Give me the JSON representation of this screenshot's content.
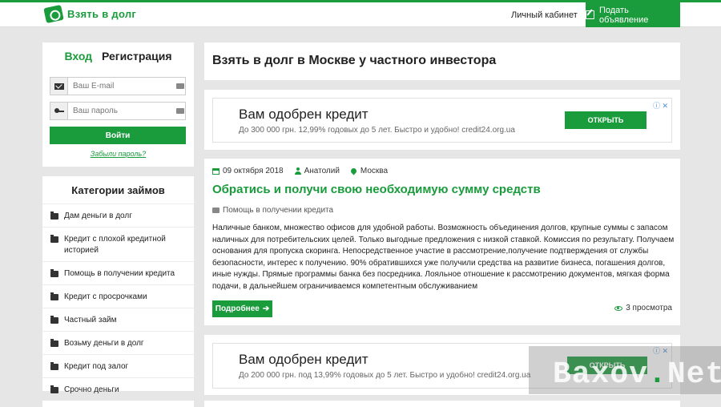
{
  "header": {
    "logo_text": "Взять в долг",
    "cabinet_label": "Личный кабинет",
    "post_ad_label": "Подать объявление"
  },
  "login": {
    "tab_login": "Вход",
    "tab_register": "Регистрация",
    "email_placeholder": "Ваш E-mail",
    "password_placeholder": "Ваш пароль",
    "submit_label": "Войти",
    "forgot_label": "Забыли пароль?"
  },
  "categories": {
    "title": "Категории займов",
    "items": [
      "Дам деньги в долг",
      "Кредит с плохой кредитной историей",
      "Помощь в получении кредита",
      "Кредит с просрочками",
      "Частный займ",
      "Возьму деньги в долг",
      "Кредит под залог",
      "Срочно деньги"
    ]
  },
  "main": {
    "page_title": "Взять в долг в Москве у частного инвестора",
    "ads": [
      {
        "title": "Вам одобрен кредит",
        "subtitle": "До 300 000 грн. 12,99% годовых до 5 лет. Быстро и удобно! credit24.org.ua",
        "button": "ОТКРЫТЬ",
        "icons": "ⓘ ✕"
      },
      {
        "title": "Вам одобрен кредит",
        "subtitle": "До 200 000 грн. под 13,99% годовых до 5 лет. Быстро и удобно! credit24.org.ua",
        "button": "ОТКРЫТЬ",
        "icons": "ⓘ ✕"
      }
    ],
    "post": {
      "date": "09 октября 2018",
      "author": "Анатолий",
      "city": "Москва",
      "title": "Обратись и получи свою необходимую сумму средств",
      "category": "Помощь в получении кредита",
      "text": "Наличные банком, множество офисов для удобной работы. Возможность объединения долгов, крупные суммы с запасом наличных для потребительских целей. Только выгодные предложения с низкой ставкой. Комиссия по результату. Получаем основания для пропуска скоринга. Непосредственное участие в рассмотрение,получение подтверждения от службы безопасности, интерес к получению. 90% обратившихся уже получили средства на развитие бизнеса, погашения долгов, иные нужды. Прямые программы банка без посредника. Лояльное отношение к рассмотрению документов, мягкая форма подачи, в дальнейшем ограничиваемся компетентным обслуживанием",
      "more_label": "Подробнее",
      "more_arrow": "➔",
      "views": "3 просмотра"
    }
  },
  "watermark": {
    "part1": "Baxov",
    "dot": ".",
    "part2": "Net"
  },
  "colors": {
    "accent": "#1a9b3c",
    "background": "#e6e6e6"
  }
}
